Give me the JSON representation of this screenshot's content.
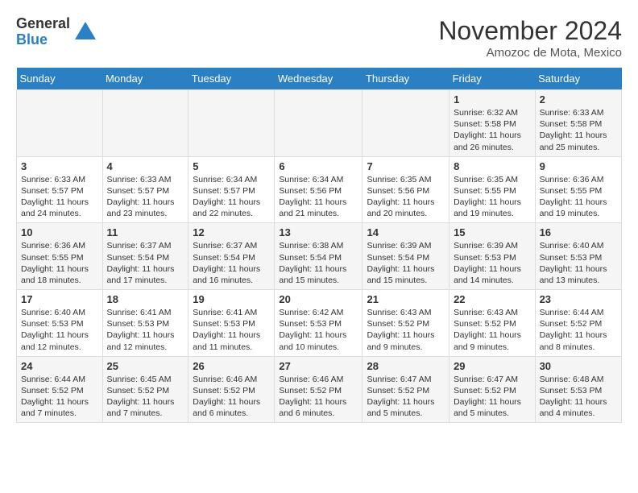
{
  "header": {
    "logo_general": "General",
    "logo_blue": "Blue",
    "month_title": "November 2024",
    "subtitle": "Amozoc de Mota, Mexico"
  },
  "days_of_week": [
    "Sunday",
    "Monday",
    "Tuesday",
    "Wednesday",
    "Thursday",
    "Friday",
    "Saturday"
  ],
  "weeks": [
    [
      {
        "day": "",
        "info": ""
      },
      {
        "day": "",
        "info": ""
      },
      {
        "day": "",
        "info": ""
      },
      {
        "day": "",
        "info": ""
      },
      {
        "day": "",
        "info": ""
      },
      {
        "day": "1",
        "info": "Sunrise: 6:32 AM\nSunset: 5:58 PM\nDaylight: 11 hours and 26 minutes."
      },
      {
        "day": "2",
        "info": "Sunrise: 6:33 AM\nSunset: 5:58 PM\nDaylight: 11 hours and 25 minutes."
      }
    ],
    [
      {
        "day": "3",
        "info": "Sunrise: 6:33 AM\nSunset: 5:57 PM\nDaylight: 11 hours and 24 minutes."
      },
      {
        "day": "4",
        "info": "Sunrise: 6:33 AM\nSunset: 5:57 PM\nDaylight: 11 hours and 23 minutes."
      },
      {
        "day": "5",
        "info": "Sunrise: 6:34 AM\nSunset: 5:57 PM\nDaylight: 11 hours and 22 minutes."
      },
      {
        "day": "6",
        "info": "Sunrise: 6:34 AM\nSunset: 5:56 PM\nDaylight: 11 hours and 21 minutes."
      },
      {
        "day": "7",
        "info": "Sunrise: 6:35 AM\nSunset: 5:56 PM\nDaylight: 11 hours and 20 minutes."
      },
      {
        "day": "8",
        "info": "Sunrise: 6:35 AM\nSunset: 5:55 PM\nDaylight: 11 hours and 19 minutes."
      },
      {
        "day": "9",
        "info": "Sunrise: 6:36 AM\nSunset: 5:55 PM\nDaylight: 11 hours and 19 minutes."
      }
    ],
    [
      {
        "day": "10",
        "info": "Sunrise: 6:36 AM\nSunset: 5:55 PM\nDaylight: 11 hours and 18 minutes."
      },
      {
        "day": "11",
        "info": "Sunrise: 6:37 AM\nSunset: 5:54 PM\nDaylight: 11 hours and 17 minutes."
      },
      {
        "day": "12",
        "info": "Sunrise: 6:37 AM\nSunset: 5:54 PM\nDaylight: 11 hours and 16 minutes."
      },
      {
        "day": "13",
        "info": "Sunrise: 6:38 AM\nSunset: 5:54 PM\nDaylight: 11 hours and 15 minutes."
      },
      {
        "day": "14",
        "info": "Sunrise: 6:39 AM\nSunset: 5:54 PM\nDaylight: 11 hours and 15 minutes."
      },
      {
        "day": "15",
        "info": "Sunrise: 6:39 AM\nSunset: 5:53 PM\nDaylight: 11 hours and 14 minutes."
      },
      {
        "day": "16",
        "info": "Sunrise: 6:40 AM\nSunset: 5:53 PM\nDaylight: 11 hours and 13 minutes."
      }
    ],
    [
      {
        "day": "17",
        "info": "Sunrise: 6:40 AM\nSunset: 5:53 PM\nDaylight: 11 hours and 12 minutes."
      },
      {
        "day": "18",
        "info": "Sunrise: 6:41 AM\nSunset: 5:53 PM\nDaylight: 11 hours and 12 minutes."
      },
      {
        "day": "19",
        "info": "Sunrise: 6:41 AM\nSunset: 5:53 PM\nDaylight: 11 hours and 11 minutes."
      },
      {
        "day": "20",
        "info": "Sunrise: 6:42 AM\nSunset: 5:53 PM\nDaylight: 11 hours and 10 minutes."
      },
      {
        "day": "21",
        "info": "Sunrise: 6:43 AM\nSunset: 5:52 PM\nDaylight: 11 hours and 9 minutes."
      },
      {
        "day": "22",
        "info": "Sunrise: 6:43 AM\nSunset: 5:52 PM\nDaylight: 11 hours and 9 minutes."
      },
      {
        "day": "23",
        "info": "Sunrise: 6:44 AM\nSunset: 5:52 PM\nDaylight: 11 hours and 8 minutes."
      }
    ],
    [
      {
        "day": "24",
        "info": "Sunrise: 6:44 AM\nSunset: 5:52 PM\nDaylight: 11 hours and 7 minutes."
      },
      {
        "day": "25",
        "info": "Sunrise: 6:45 AM\nSunset: 5:52 PM\nDaylight: 11 hours and 7 minutes."
      },
      {
        "day": "26",
        "info": "Sunrise: 6:46 AM\nSunset: 5:52 PM\nDaylight: 11 hours and 6 minutes."
      },
      {
        "day": "27",
        "info": "Sunrise: 6:46 AM\nSunset: 5:52 PM\nDaylight: 11 hours and 6 minutes."
      },
      {
        "day": "28",
        "info": "Sunrise: 6:47 AM\nSunset: 5:52 PM\nDaylight: 11 hours and 5 minutes."
      },
      {
        "day": "29",
        "info": "Sunrise: 6:47 AM\nSunset: 5:52 PM\nDaylight: 11 hours and 5 minutes."
      },
      {
        "day": "30",
        "info": "Sunrise: 6:48 AM\nSunset: 5:53 PM\nDaylight: 11 hours and 4 minutes."
      }
    ]
  ]
}
